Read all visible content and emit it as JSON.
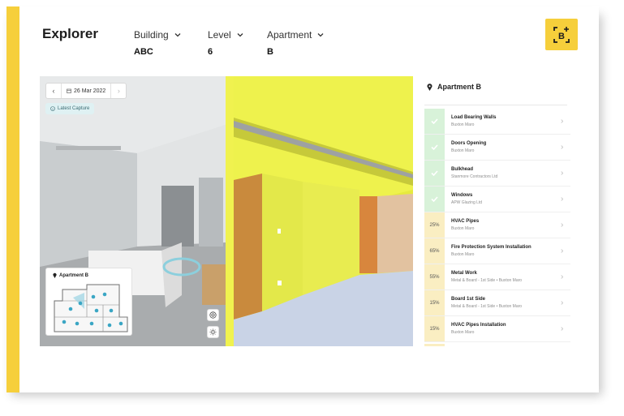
{
  "app": {
    "title": "Explorer",
    "logo_text": "B"
  },
  "filters": [
    {
      "label": "Building",
      "value": "ABC"
    },
    {
      "label": "Level",
      "value": "6"
    },
    {
      "label": "Apartment",
      "value": "B"
    }
  ],
  "viewer": {
    "date": "26 Mar 2022",
    "capture_tag": "Latest Capture",
    "minimap_title": "Apartment B"
  },
  "panel": {
    "title": "Apartment B",
    "items": [
      {
        "status": "check",
        "name": "Load Bearing Walls",
        "sub": "Buxton Maro"
      },
      {
        "status": "check",
        "name": "Doors Opening",
        "sub": "Buxton Maro"
      },
      {
        "status": "check",
        "name": "Bulkhead",
        "sub": "Stanmore Contractors Ltd"
      },
      {
        "status": "check",
        "name": "Windows",
        "sub": "APW Glazing Ltd"
      },
      {
        "status": "25%",
        "name": "HVAC Pipes",
        "sub": "Buxton Maro"
      },
      {
        "status": "65%",
        "name": "Fire Protection System Installation",
        "sub": "Buxton Maro"
      },
      {
        "status": "55%",
        "name": "Metal Work",
        "sub": "Metal & Board - 1st Side  •  Buxton Maro"
      },
      {
        "status": "15%",
        "name": "Board 1st Side",
        "sub": "Metal & Board - 1st Side  •  Buxton Maro"
      },
      {
        "status": "15%",
        "name": "HVAC Pipes Installation",
        "sub": "Buxton Maro"
      }
    ]
  },
  "colors": {
    "accent": "#f6cf3b",
    "done": "#d8f2d9",
    "progress": "#faeec2",
    "model_yellow": "#e9ec3f"
  }
}
